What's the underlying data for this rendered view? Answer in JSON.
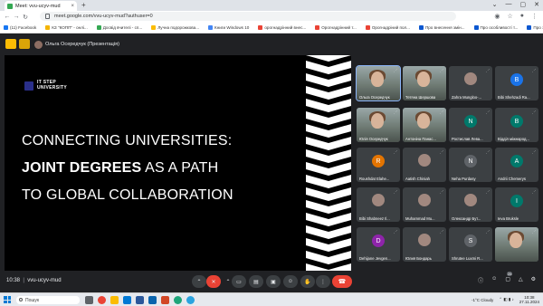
{
  "browser": {
    "tab_title": "Meet: vvu-ucyv-mud",
    "new_tab_label": "+",
    "url": "meet.google.com/vvu-ucyv-mud?authuser=0",
    "window_controls": [
      "⌄",
      "—",
      "▢",
      "✕"
    ]
  },
  "bookmarks": [
    {
      "label": "(11) Facebook",
      "icon_color": "#1877f2"
    },
    {
      "label": "КЗ \"КОПП\" - онлі...",
      "icon_color": "#f4b400"
    },
    {
      "label": "Досвід вчителі - сп...",
      "icon_color": "#34a853"
    },
    {
      "label": "Лучна подорожкова...",
      "icon_color": "#fbbc04"
    },
    {
      "label": "Книги Windows 10",
      "icon_color": "#4285f4"
    },
    {
      "label": "орогнадрінний внес...",
      "icon_color": "#ea4335"
    },
    {
      "label": "Орогнадрінний т...",
      "icon_color": "#ea4335"
    },
    {
      "label": "Орогнадріний пол...",
      "icon_color": "#ea4335"
    },
    {
      "label": "Про внесення змін...",
      "icon_color": "#0b57d0"
    },
    {
      "label": "Про особливості т...",
      "icon_color": "#0b57d0"
    },
    {
      "label": "Про затвердження...",
      "icon_color": "#0b57d0"
    },
    {
      "label": "Про затвердження...",
      "icon_color": "#0b57d0"
    }
  ],
  "meet": {
    "presenter_label": "Ольга Осередчук (Презентація)",
    "meeting_time": "10:38",
    "meeting_code": "vvu-ucyv-mud",
    "participant_count": "26"
  },
  "slide": {
    "logo_line1": "IT STEP",
    "logo_line2": "UNIVERSITY",
    "line1": "CONNECTING UNIVERSITIES:",
    "line2_bold": "JOINT DEGREES",
    "line2_rest": " AS A PATH",
    "line3": "TO GLOBAL COLLABORATION"
  },
  "participants": [
    {
      "name": "Ольга Осередчук",
      "type": "video",
      "active": true
    },
    {
      "name": "Тетяна Шершова",
      "type": "video"
    },
    {
      "name": "Zahra Mungloo-...",
      "type": "photo"
    },
    {
      "name": "Bibi Shehzadi Ra...",
      "type": "letter",
      "letter": "B",
      "color": "#1a73e8"
    },
    {
      "name": "Юлія Осередчук",
      "type": "video"
    },
    {
      "name": "Антоніна Панас...",
      "type": "video"
    },
    {
      "name": "Ростислав Лева...",
      "type": "letter",
      "letter": "N",
      "color": "#00796b"
    },
    {
      "name": "Відділ міжнарод...",
      "type": "letter",
      "letter": "B",
      "color": "#00796b"
    },
    {
      "name": "Roushdat Elahe...",
      "type": "letter",
      "letter": "R",
      "color": "#e37400"
    },
    {
      "name": "Aatish Chiniah",
      "type": "photo"
    },
    {
      "name": "Neha Purdasy",
      "type": "letter",
      "letter": "N",
      "color": "#5f6368"
    },
    {
      "name": "Andrii Chemerys",
      "type": "letter",
      "letter": "A",
      "color": "#00796b"
    },
    {
      "name": "Bibi Shabneez Il...",
      "type": "photo"
    },
    {
      "name": "Muhammad Mu...",
      "type": "photo"
    },
    {
      "name": "Олександр Бут...",
      "type": "photo"
    },
    {
      "name": "Ieva Bruksle",
      "type": "letter",
      "letter": "I",
      "color": "#00796b"
    },
    {
      "name": "Dehijane Jevgen...",
      "type": "letter",
      "letter": "D",
      "color": "#8e24aa"
    },
    {
      "name": "Юлия Бондарь",
      "type": "photo"
    },
    {
      "name": "Shrutee Luxmi R...",
      "type": "letter",
      "letter": "S",
      "color": "#5f6368"
    },
    {
      "name": "",
      "type": "video"
    }
  ],
  "controls": {
    "hangup_icon": "phone-down-icon",
    "buttons": [
      "more-icon",
      "mic-off-icon",
      "options-icon",
      "camera-icon",
      "captions-icon",
      "present-icon",
      "emoji-icon",
      "raise-hand-icon",
      "more-options-icon"
    ],
    "right": [
      "info-icon",
      "people-icon",
      "chat-icon",
      "activities-icon",
      "host-icon"
    ]
  },
  "taskbar": {
    "search_placeholder": "Пошук",
    "weather": "-1°C Cloudy",
    "time": "10:38",
    "date": "27.11.2024"
  }
}
